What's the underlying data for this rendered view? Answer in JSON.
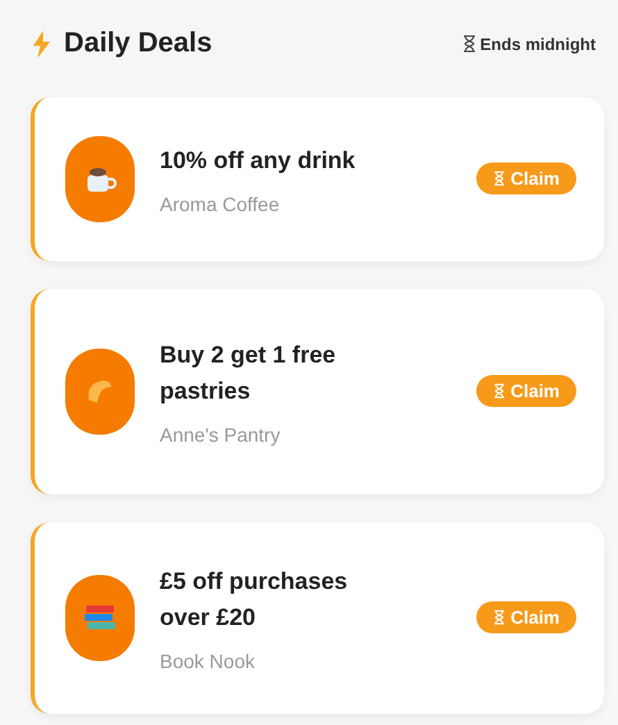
{
  "header": {
    "title": "Daily Deals",
    "timer": "Ends midnight"
  },
  "deals": [
    {
      "kind": "coffee",
      "title": "10% off any drink",
      "shop": "Aroma Coffee",
      "button": "Claim"
    },
    {
      "kind": "pastry",
      "title": "Buy 2 get 1 free pastries",
      "shop": "Anne's Pantry",
      "button": "Claim"
    },
    {
      "kind": "books",
      "title": "£5 off purchases over £20",
      "shop": "Book Nook",
      "button": "Claim"
    }
  ]
}
